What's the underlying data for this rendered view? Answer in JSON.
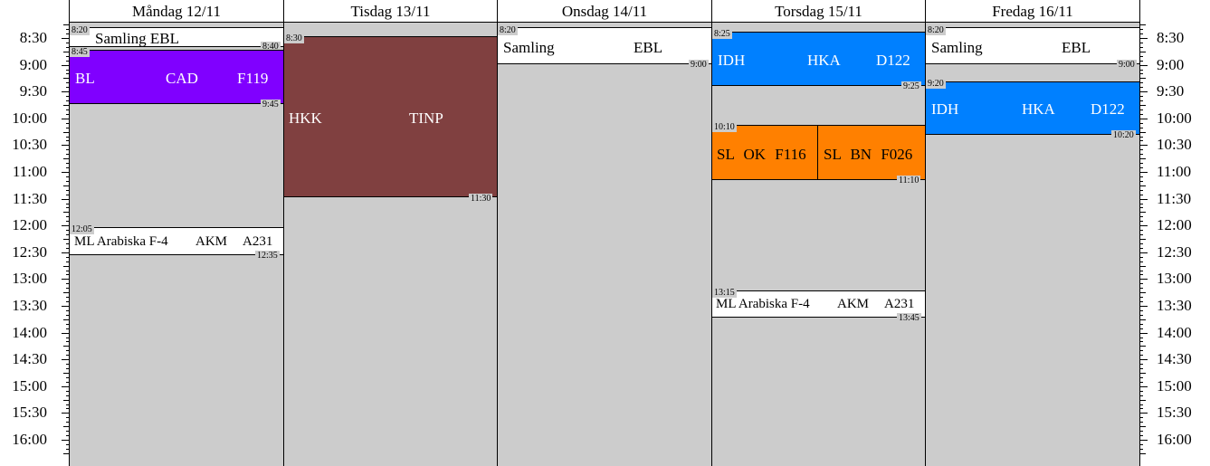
{
  "days": [
    {
      "label": "Måndag 12/11"
    },
    {
      "label": "Tisdag 13/11"
    },
    {
      "label": "Onsdag 14/11"
    },
    {
      "label": "Torsdag 15/11"
    },
    {
      "label": "Fredag 16/11"
    }
  ],
  "time_labels": [
    "8:30",
    "9:00",
    "9:30",
    "10:00",
    "10:30",
    "11:00",
    "11:30",
    "12:00",
    "12:30",
    "13:00",
    "13:30",
    "14:00",
    "14:30",
    "15:00",
    "15:30",
    "16:00"
  ],
  "colors": {
    "column_bg": "#cccccc",
    "purple": "#8000ff",
    "brown": "#804040",
    "blue": "#0080ff",
    "orange": "#ff8000",
    "white": "#ffffff"
  },
  "events": {
    "mon_samling": {
      "start": "8:20",
      "end": "8:40",
      "texts": [
        "Samling EBL"
      ]
    },
    "mon_bl": {
      "start": "8:45",
      "end": "9:45",
      "texts": [
        "BL",
        "CAD",
        "F119"
      ]
    },
    "mon_ml": {
      "start": "12:05",
      "end": "12:35",
      "texts": [
        "ML Arabiska F-4",
        "AKM",
        "A231"
      ]
    },
    "tue_hkk": {
      "start": "8:30",
      "end": "11:30",
      "texts": [
        "HKK",
        "TINP"
      ]
    },
    "wed_samling": {
      "start": "8:20",
      "end": "9:00",
      "texts": [
        "Samling",
        "EBL"
      ]
    },
    "thu_idh": {
      "start": "8:25",
      "end": "9:25",
      "texts": [
        "IDH",
        "HKA",
        "D122"
      ]
    },
    "thu_sl1": {
      "start": "10:10",
      "texts": [
        "SL OK F116"
      ]
    },
    "thu_sl2": {
      "end": "11:10",
      "texts": [
        "SL BN F026"
      ]
    },
    "thu_ml": {
      "start": "13:15",
      "end": "13:45",
      "texts": [
        "ML Arabiska F-4",
        "AKM",
        "A231"
      ]
    },
    "fri_samling": {
      "start": "8:20",
      "end": "9:00",
      "texts": [
        "Samling",
        "EBL"
      ]
    },
    "fri_idh": {
      "start": "9:20",
      "end": "10:20",
      "texts": [
        "IDH",
        "HKA",
        "D122"
      ]
    }
  }
}
